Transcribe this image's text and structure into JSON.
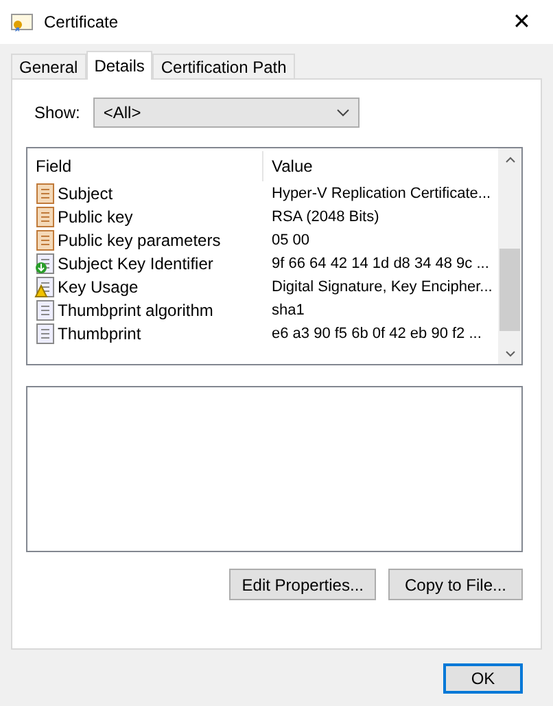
{
  "window": {
    "title": "Certificate",
    "close": "✕"
  },
  "tabs": [
    {
      "label": "General",
      "selected": false
    },
    {
      "label": "Details",
      "selected": true
    },
    {
      "label": "Certification Path",
      "selected": false
    }
  ],
  "show": {
    "label": "Show:",
    "value": "<All>"
  },
  "table": {
    "columns": [
      "Field",
      "Value"
    ],
    "rows": [
      {
        "kind": "field",
        "field": "Subject",
        "value": "Hyper-V Replication Certificate..."
      },
      {
        "kind": "field",
        "field": "Public key",
        "value": "RSA (2048 Bits)"
      },
      {
        "kind": "field",
        "field": "Public key parameters",
        "value": "05 00"
      },
      {
        "kind": "extension",
        "field": "Subject Key Identifier",
        "value": "9f 66 64 42 14 1d d8 34 48 9c ..."
      },
      {
        "kind": "critical",
        "field": "Key Usage",
        "value": "Digital Signature, Key Encipher..."
      },
      {
        "kind": "property",
        "field": "Thumbprint algorithm",
        "value": "sha1"
      },
      {
        "kind": "property",
        "field": "Thumbprint",
        "value": "e6 a3 90 f5 6b 0f 42 eb 90 f2 ..."
      }
    ]
  },
  "buttons": [
    "Edit Properties...",
    "Copy to File..."
  ],
  "ok": "OK"
}
